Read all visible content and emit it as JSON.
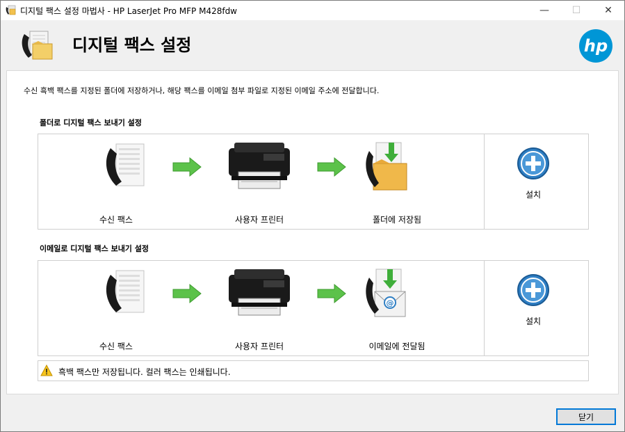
{
  "window": {
    "title": "디지털 팩스 설정 마법사 - HP LaserJet Pro MFP M428fdw",
    "minimize_glyph": "—",
    "maximize_glyph": "☐",
    "close_glyph": "✕"
  },
  "header": {
    "title": "디지털 팩스 설정",
    "logo_text": "hp"
  },
  "intro": "수신 흑백 팩스를 지정된 폴더에 저장하거나, 해당 팩스를 이메일 첨부 파일로 지정된 이메일 주소에 전달합니다.",
  "sections": [
    {
      "label": "폴더로 디지털 팩스 보내기 설정",
      "steps": [
        "수신 팩스",
        "사용자 프린터",
        "폴더에 저장됨"
      ],
      "setup_label": "설치"
    },
    {
      "label": "이메일로 디지털 팩스 보내기 설정",
      "steps": [
        "수신 팩스",
        "사용자 프린터",
        "이메일에 전달됨"
      ],
      "setup_label": "설치"
    }
  ],
  "warning": "흑백 팩스만 저장됩니다. 컬러 팩스는 인쇄됩니다.",
  "footer": {
    "close_label": "닫기"
  },
  "colors": {
    "hp_blue": "#0096d6",
    "arrow_green": "#5cc24a",
    "focus_blue": "#0078d7"
  }
}
